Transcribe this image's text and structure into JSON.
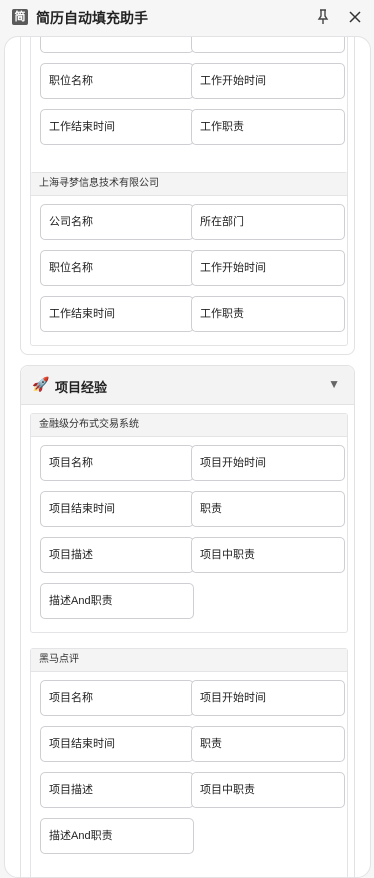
{
  "window": {
    "icon_char": "简",
    "title": "简历自动填充助手"
  },
  "work": {
    "group1": {
      "fields": [
        "职位名称",
        "工作开始时间",
        "工作结束时间",
        "工作职责"
      ]
    },
    "group2": {
      "title": "上海寻梦信息技术有限公司",
      "fields": [
        "公司名称",
        "所在部门",
        "职位名称",
        "工作开始时间",
        "工作结束时间",
        "工作职责"
      ]
    }
  },
  "projects": {
    "header": {
      "emoji": "🚀",
      "title": "项目经验",
      "toggle": "▼"
    },
    "group1": {
      "title": "金融级分布式交易系统",
      "fields": [
        "项目名称",
        "项目开始时间",
        "项目结束时间",
        "职责",
        "项目描述",
        "项目中职责",
        "描述And职责"
      ]
    },
    "group2": {
      "title": "黑马点评",
      "fields": [
        "项目名称",
        "项目开始时间",
        "项目结束时间",
        "职责",
        "项目描述",
        "项目中职责",
        "描述And职责"
      ]
    }
  }
}
